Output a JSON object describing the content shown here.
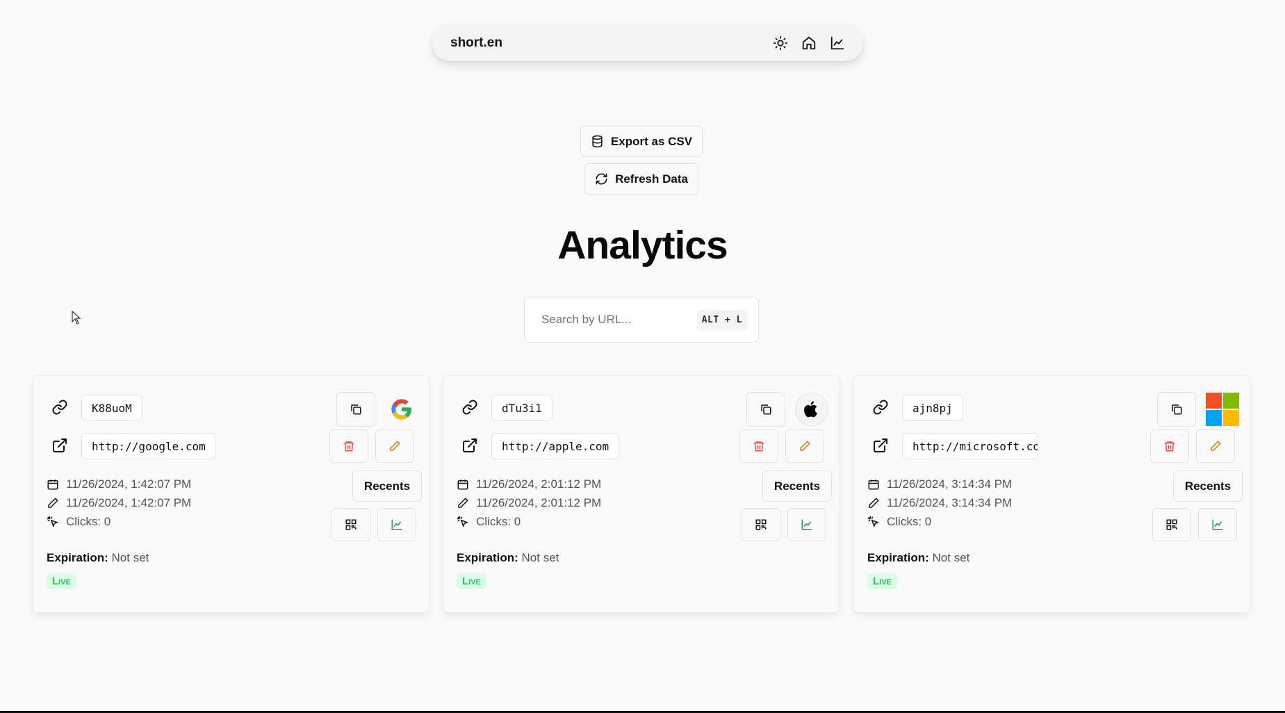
{
  "nav": {
    "brand": "short.en",
    "icons": [
      "sun-icon",
      "home-icon",
      "chart-icon"
    ]
  },
  "actions": {
    "export_label": "Export as CSV",
    "refresh_label": "Refresh Data"
  },
  "page": {
    "title": "Analytics"
  },
  "search": {
    "placeholder": "Search by URL...",
    "shortcut": "ALT + L"
  },
  "cards": [
    {
      "code": "K88uoM",
      "url": "http://google.com",
      "created": "11/26/2024, 1:42:07 PM",
      "updated": "11/26/2024, 1:42:07 PM",
      "clicks": "Clicks: 0",
      "recents_label": "Recents",
      "expiration_label": "Expiration:",
      "expiration_value": "Not set",
      "status": "Live",
      "logo": "google-logo-icon"
    },
    {
      "code": "dTu3i1",
      "url": "http://apple.com",
      "created": "11/26/2024, 2:01:12 PM",
      "updated": "11/26/2024, 2:01:12 PM",
      "clicks": "Clicks: 0",
      "recents_label": "Recents",
      "expiration_label": "Expiration:",
      "expiration_value": "Not set",
      "status": "Live",
      "logo": "apple-logo-icon"
    },
    {
      "code": "ajn8pj",
      "url": "http://microsoft.com",
      "created": "11/26/2024, 3:14:34 PM",
      "updated": "11/26/2024, 3:14:34 PM",
      "clicks": "Clicks: 0",
      "recents_label": "Recents",
      "expiration_label": "Expiration:",
      "expiration_value": "Not set",
      "status": "Live",
      "logo": "microsoft-logo-icon"
    }
  ],
  "colors": {
    "delete": "#ef4444",
    "edit": "#d97706",
    "chart": "#16a34a",
    "live_bg": "#dcfce7",
    "live_text": "#22c55e"
  }
}
